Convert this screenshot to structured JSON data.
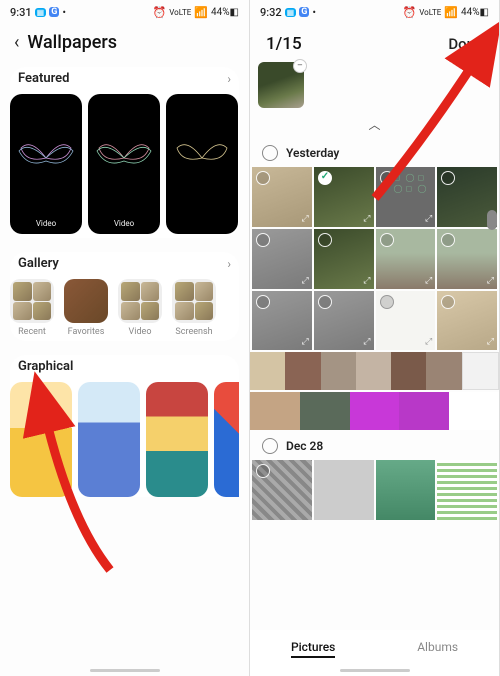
{
  "left": {
    "status": {
      "time": "9:31",
      "battery": "44%"
    },
    "header": {
      "title": "Wallpapers"
    },
    "sections": {
      "featured": {
        "title": "Featured",
        "items": [
          {
            "label": "Video"
          },
          {
            "label": "Video"
          },
          {
            "label": ""
          }
        ]
      },
      "gallery": {
        "title": "Gallery",
        "items": [
          {
            "label": "Recent"
          },
          {
            "label": "Favorites"
          },
          {
            "label": "Video"
          },
          {
            "label": "Screensh"
          }
        ]
      },
      "graphical": {
        "title": "Graphical"
      }
    }
  },
  "right": {
    "status": {
      "time": "9:32",
      "battery": "44%"
    },
    "counter": "1/15",
    "done": "Done",
    "groups": [
      {
        "label": "Yesterday"
      },
      {
        "label": "Dec 28"
      }
    ],
    "tabs": {
      "pictures": "Pictures",
      "albums": "Albums"
    }
  }
}
